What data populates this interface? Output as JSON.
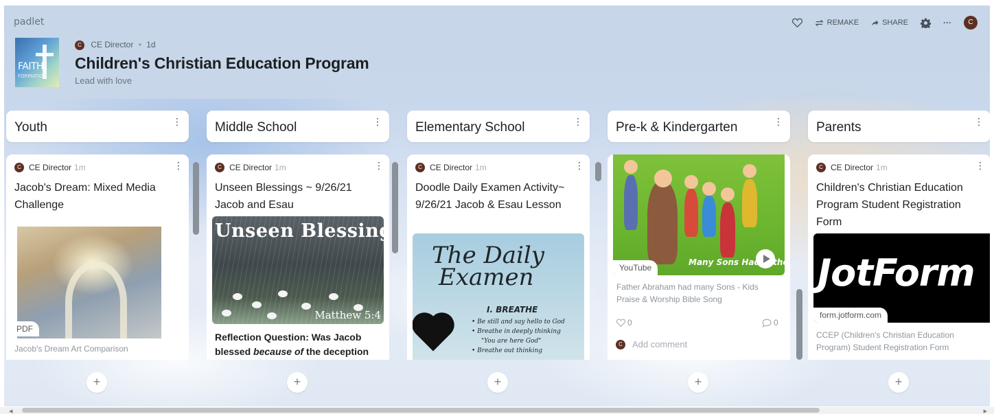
{
  "header": {
    "brand": "padlet",
    "logo_text": "FAITH",
    "logo_subtext": "FORMATION",
    "author_initial": "C",
    "author": "CE Director",
    "separator": "•",
    "time": "1d",
    "title": "Children's Christian Education Program",
    "subtitle": "Lead with love",
    "toolbar": {
      "remake_label": "REMAKE",
      "share_label": "SHARE",
      "more_label": "···",
      "avatar_initial": "C"
    }
  },
  "columns": [
    {
      "title": "Youth",
      "menu": "⋮",
      "card": {
        "author_initial": "C",
        "author": "CE Director",
        "time": "1m",
        "title": "Jacob's Dream: Mixed Media Challenge",
        "attachment_badge": "PDF",
        "caption": "Jacob's Dream Art Comparison"
      }
    },
    {
      "title": "Middle School",
      "menu": "⋮",
      "card": {
        "author_initial": "C",
        "author": "CE Director",
        "time": "1m",
        "title": "Unseen Blessings ~ 9/26/21 Jacob and Esau",
        "image_heading": "Unseen Blessings",
        "image_reference": "Matthew 5:4",
        "body_prefix": "Reflection Question: Was Jacob blessed ",
        "body_emphasis": "because of",
        "body_suffix": " the deception"
      }
    },
    {
      "title": "Elementary School",
      "menu": "⋮",
      "card": {
        "author_initial": "C",
        "author": "CE Director",
        "time": "1m",
        "title": "Doodle Daily Examen Activity~ 9/26/21 Jacob & Esau Lesson",
        "image_title_1": "The Daily",
        "image_title_2": "Examen",
        "image_step": "I. BREATHE",
        "image_bullets": [
          "• Be still and say hello to God",
          "• Breathe in deeply thinking",
          "\"You are here God\"",
          "• Breathe out thinking"
        ]
      }
    },
    {
      "title": "Pre-k & Kindergarten",
      "menu": "⋮",
      "card": {
        "video_overlay": "Many Sons Had Father Abraha",
        "source_badge": "YouTube",
        "caption": "Father Abraham had many Sons - Kids Praise & Worship Bible Song",
        "likes": "0",
        "comments": "0",
        "commenter_initial": "C",
        "add_comment": "Add comment"
      }
    },
    {
      "title": "Parents",
      "menu": "⋮",
      "card": {
        "author_initial": "C",
        "author": "CE Director",
        "time": "1m",
        "title": "Children's Christian Education Program Student Registration Form",
        "image_text": "JotForm",
        "url_badge": "form.jotform.com",
        "caption": "CCEP (Children's Christian Education Program) Student Registration Form"
      }
    }
  ],
  "add_post_label": "+",
  "colors": {
    "header_bg": "#c8d7e8",
    "avatar": "#5d2f22",
    "scroll_thumb": "#8a9199"
  }
}
